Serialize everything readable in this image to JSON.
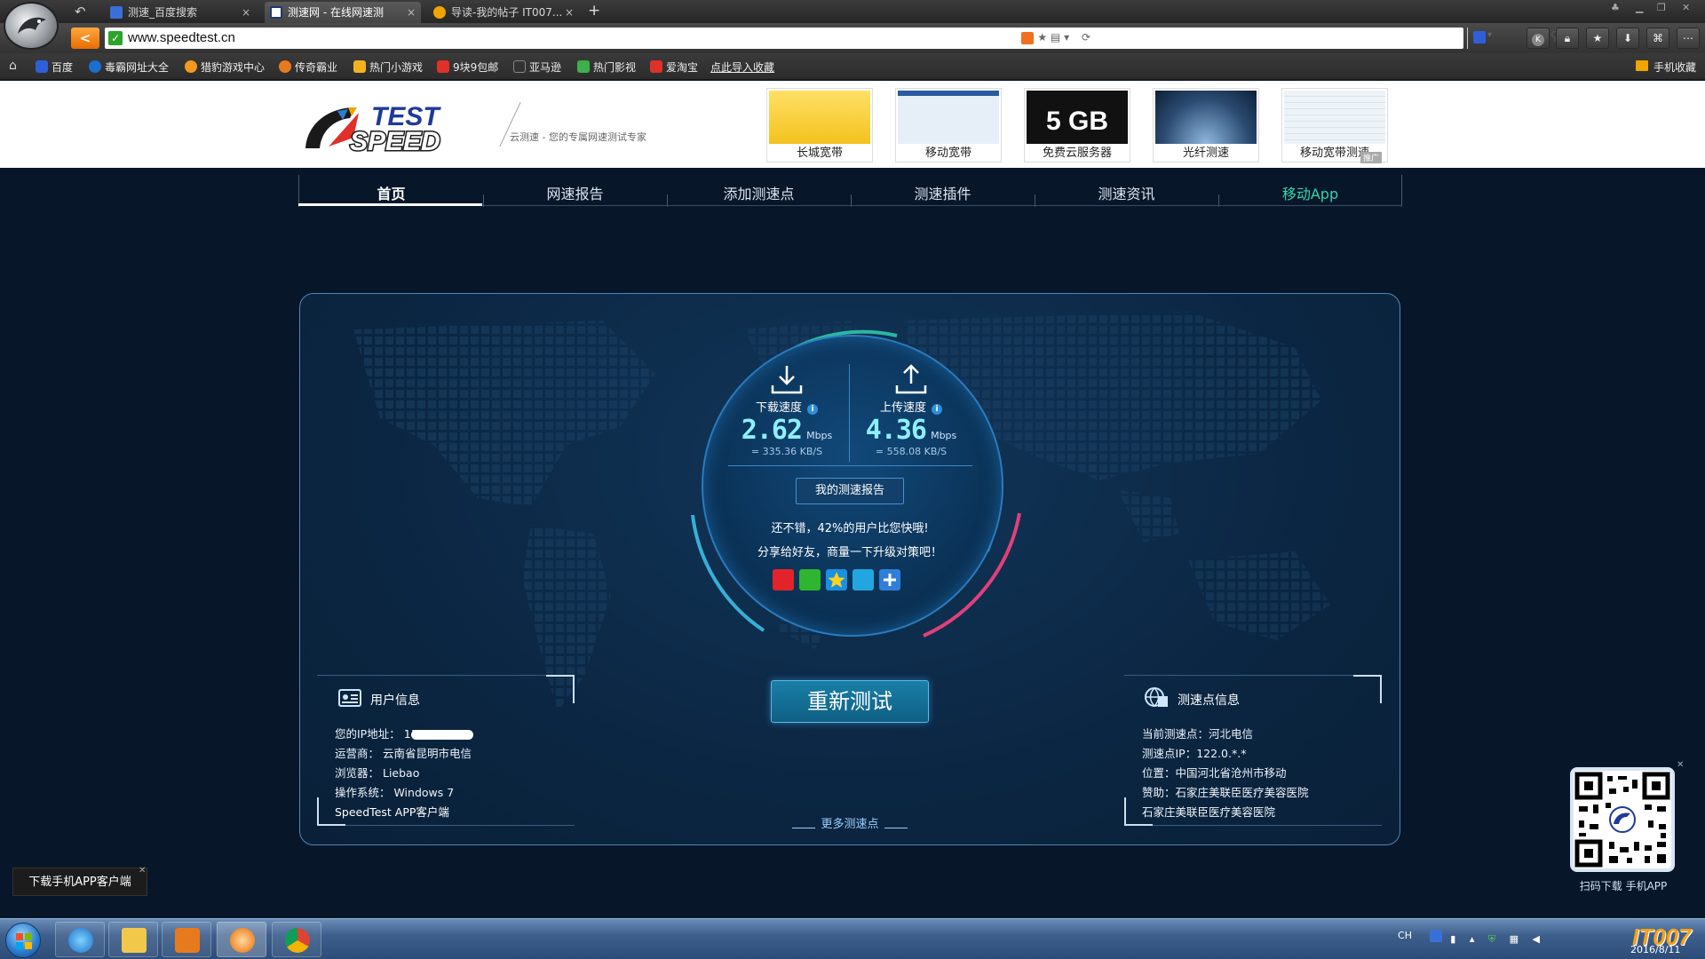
{
  "browser": {
    "tabs": [
      {
        "title": "测速_百度搜索",
        "active": false,
        "icon_color": "#3b6fd8"
      },
      {
        "title": "测速网 - 在线网速测",
        "active": true,
        "icon_color": "#1e3a70"
      },
      {
        "title": "导读-我的帖子 IT007...",
        "active": false,
        "icon_color": "#f0a500"
      }
    ],
    "tab_close": "×",
    "new_tab": "+",
    "url": "www.speedtest.cn",
    "bookmarks": [
      {
        "label": "百度",
        "color": "#2f5fd8"
      },
      {
        "label": "毒霸网址大全",
        "color": "#1a6fd0"
      },
      {
        "label": "猎豹游戏中心",
        "color": "#f39a1e"
      },
      {
        "label": "传奇霸业",
        "color": "#e87a1e"
      },
      {
        "label": "热门小游戏",
        "color": "#f0b21e"
      },
      {
        "label": "9块9包邮",
        "color": "#e0302a"
      },
      {
        "label": "亚马逊",
        "color": "#333333"
      },
      {
        "label": "热门影视",
        "color": "#3cb04a"
      },
      {
        "label": "爱淘宝",
        "color": "#e0302a"
      },
      {
        "label": "点此导入收藏",
        "color": ""
      }
    ],
    "bookmark_right": "手机收藏"
  },
  "site": {
    "tagline": "云测速 - 您的专属网速测试专家",
    "ads": [
      {
        "label": "长城宽带",
        "color": "#f4c21e"
      },
      {
        "label": "移动宽带",
        "color": "#e6eef8"
      },
      {
        "label": "免费云服务器",
        "banner": "5 GB",
        "color": "#111111"
      },
      {
        "label": "光纤测速",
        "color": "#2a4a70"
      },
      {
        "label": "移动宽带测速",
        "color": "#eef3f8"
      }
    ],
    "ad_tag": "推广",
    "nav": [
      "首页",
      "网速报告",
      "添加测速点",
      "测速插件",
      "测速资讯",
      "移动App"
    ],
    "download": {
      "label": "下载速度",
      "value": "2.62",
      "unit": "Mbps",
      "kbs": "= 335.36  KB/S"
    },
    "upload": {
      "label": "上传速度",
      "value": "4.36",
      "unit": "Mbps",
      "kbs": "= 558.08  KB/S"
    },
    "info_i": "i",
    "report_button": "我的测速报告",
    "result_line1": "还不错，42%的用户比您快哦!",
    "result_line2": "分享给好友，商量一下升级对策吧！",
    "share_icons": [
      {
        "name": "weibo-icon",
        "color": "#e2232a"
      },
      {
        "name": "wechat-icon",
        "color": "#2fb52f"
      },
      {
        "name": "qzone-icon",
        "color": "#1b8fe0"
      },
      {
        "name": "tencent-weibo-icon",
        "color": "#22a6e0"
      },
      {
        "name": "more-share-icon",
        "color": "#2f7fd8"
      }
    ],
    "retest_button": "重新测试",
    "more_points": "更多测速点",
    "user_info": {
      "title": "用户信息",
      "ip_label": "您的IP地址：",
      "ip_partial": "11",
      "isp": "运营商： 云南省昆明市电信",
      "browser": "浏览器： Liebao",
      "os": "操作系统： Windows 7",
      "app": "SpeedTest APP客户端"
    },
    "point_info": {
      "title": "测速点信息",
      "current": "当前测速点：河北电信",
      "ip": "测速点IP：122.0.*.*",
      "location": "位置：中国河北省沧州市移动",
      "sponsor": "赞助：石家庄美联臣医疗美容医院",
      "sponsor2": "石家庄美联臣医疗美容医院"
    },
    "download_app": "下载手机APP客户端",
    "qr_caption": "扫码下载 手机APP"
  },
  "taskbar": {
    "tray_text": "CH",
    "date": "2016/8/11",
    "watermark": "IT007"
  }
}
